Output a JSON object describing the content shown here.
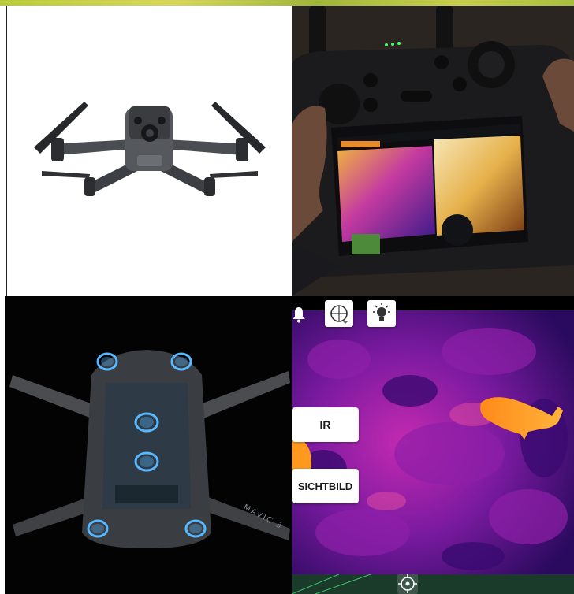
{
  "collage": {
    "panels": [
      {
        "name": "drone-product-photo"
      },
      {
        "name": "remote-controller-thermal-view"
      },
      {
        "name": "drone-xray-underside"
      },
      {
        "name": "thermal-camera-app-view"
      }
    ]
  },
  "drone_xray": {
    "model_text": "MAVIC 3"
  },
  "thermal_app": {
    "ir_label": "IR",
    "visible_label": "SICHTBILD",
    "icons": [
      "bell-icon",
      "gimbal-icon",
      "light-bulb-icon",
      "crosshair-icon"
    ]
  },
  "colors": {
    "thermal_dark": "#2a0a5e",
    "thermal_mid": "#b01ca8",
    "thermal_hot": "#ff9a1e"
  }
}
